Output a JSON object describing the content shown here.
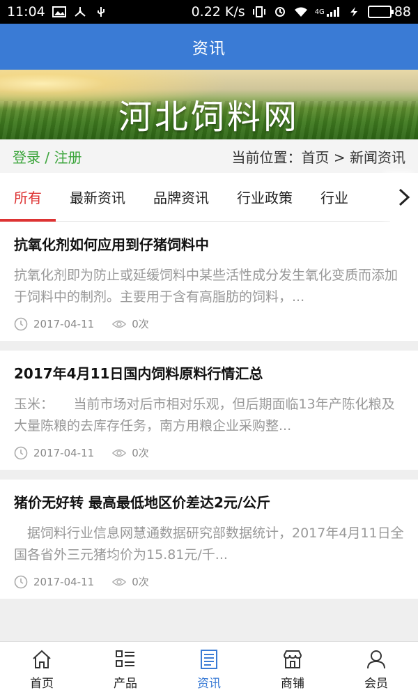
{
  "status_bar": {
    "time": "11:04",
    "net_speed": "0.22 K/s",
    "signal_label": "4G",
    "battery": "88"
  },
  "app_bar": {
    "title": "资讯"
  },
  "banner": {
    "logo_text": "河北饲料网"
  },
  "location_bar": {
    "auth": "登录 / 注册",
    "breadcrumb": "当前位置：首页 > 新闻资讯"
  },
  "tabs": [
    {
      "label": "所有",
      "active": true
    },
    {
      "label": "最新资讯"
    },
    {
      "label": "品牌资讯"
    },
    {
      "label": "行业政策"
    },
    {
      "label": "行业"
    }
  ],
  "articles": [
    {
      "title": "抗氧化剂如何应用到仔猪饲料中",
      "summary": "抗氧化剂即为防止或延缓饲料中某些活性成分发生氧化变质而添加于饲料中的制剂。主要用于含有高脂肪的饲料，...",
      "date": "2017-04-11",
      "views": "0次"
    },
    {
      "title": "2017年4月11日国内饲料原料行情汇总",
      "summary": "玉米：　　当前市场对后市相对乐观，但后期面临13年产陈化粮及大量陈粮的去库存任务，南方用粮企业采购整...",
      "date": "2017-04-11",
      "views": "0次"
    },
    {
      "title": "猪价无好转 最高最低地区价差达2元/公斤",
      "summary": "　据饲料行业信息网慧通数据研究部数据统计，2017年4月11日全国各省外三元猪均价为15.81元/千...",
      "date": "2017-04-11",
      "views": "0次"
    }
  ],
  "bottom_nav": [
    {
      "label": "首页",
      "icon": "home-icon"
    },
    {
      "label": "产品",
      "icon": "list-icon"
    },
    {
      "label": "资讯",
      "icon": "news-icon",
      "active": true
    },
    {
      "label": "商铺",
      "icon": "shop-icon"
    },
    {
      "label": "会员",
      "icon": "user-icon"
    }
  ],
  "colors": {
    "app_bar": "#3a7bd5",
    "tab_active": "#dd3333",
    "auth_link": "#3ca53c",
    "nav_active": "#3a7bd5"
  }
}
